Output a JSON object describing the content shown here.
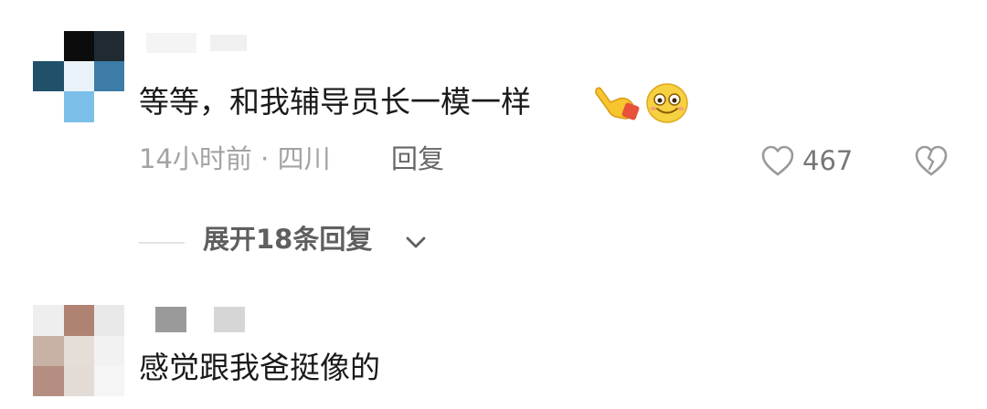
{
  "comments": [
    {
      "text_main": "等等，和我辅导员长一模一样",
      "emojis": [
        "pointing-hand-emoji",
        "smiling-face-emoji"
      ],
      "time": "14小时前",
      "separator": "·",
      "location": "四川",
      "reply_label": "回复",
      "likes": "467",
      "icons": {
        "like": "heart-outline-icon",
        "dislike": "broken-heart-icon"
      }
    },
    {
      "text_main": "感觉跟我爸挺像的"
    }
  ],
  "expand_replies": {
    "label": "展开18条回复",
    "icon": "chevron-down-icon"
  }
}
